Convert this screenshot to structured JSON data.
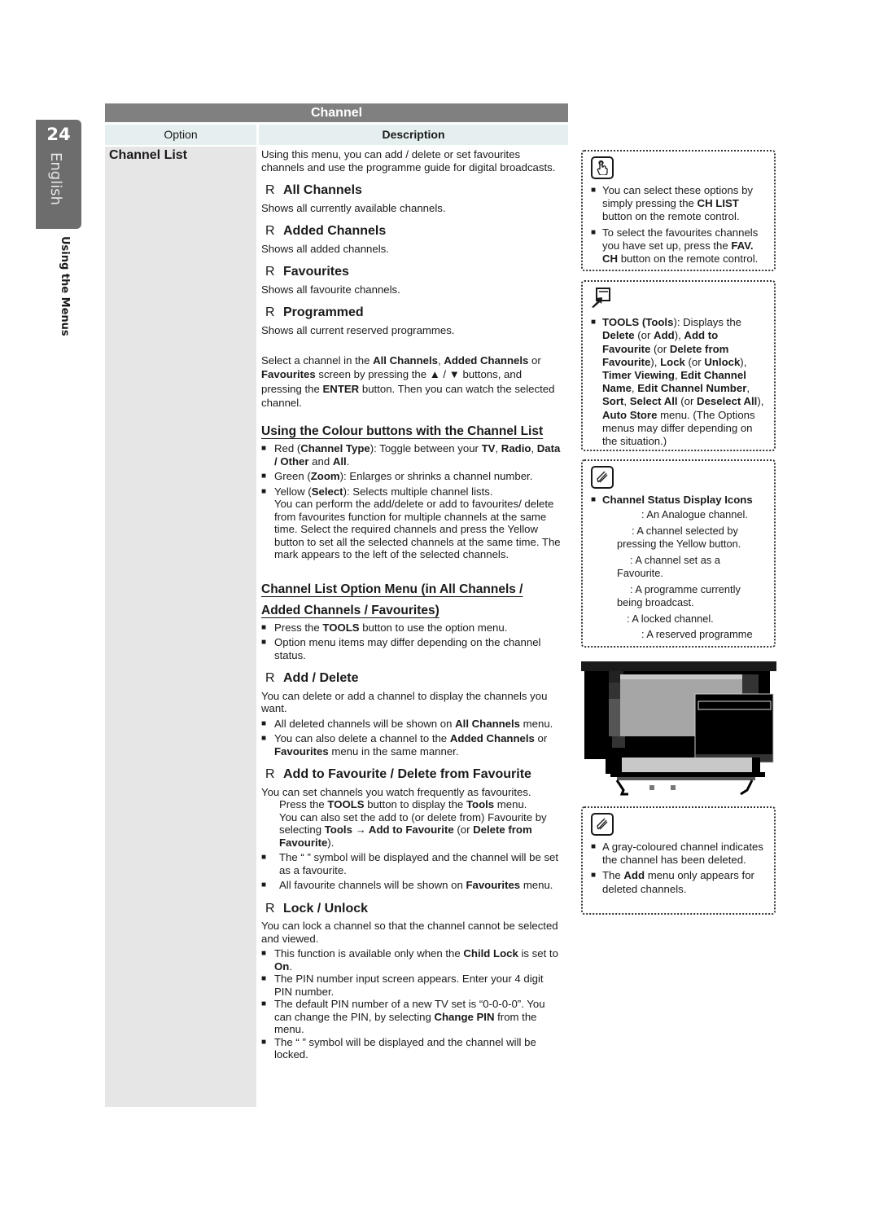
{
  "sidebar": {
    "page_number": "24",
    "language": "English",
    "section": "Using the Menus"
  },
  "table": {
    "title": "Channel",
    "col_option": "Option",
    "col_description": "Description",
    "option_name": "Channel List"
  },
  "desc": {
    "intro": "Using this menu, you can add / delete or set favourites channels and use the programme guide for digital broadcasts.",
    "items": [
      {
        "marker": "R",
        "title": "All Channels",
        "text": "Shows all currently available channels."
      },
      {
        "marker": "R",
        "title": "Added Channels",
        "text": "Shows all added channels."
      },
      {
        "marker": "R",
        "title": "Favourites",
        "text": "Shows all favourite channels."
      },
      {
        "marker": "R",
        "title": "Programmed",
        "text": "Shows all current reserved programmes."
      }
    ],
    "select_para": {
      "t1": "Select a channel in the ",
      "b1": "All Channels",
      "t2": ", ",
      "b2": "Added Channels",
      "t3": " or ",
      "b3": "Favourites",
      "t4": " screen by pressing the ▲ / ▼ buttons, and pressing the ",
      "b4": "ENTER",
      "t5": "      button. Then you can watch the selected channel."
    },
    "colour_heading": "Using the Colour buttons with the Channel List",
    "colour_items": {
      "red": {
        "a": "Red (",
        "b": "Channel Type",
        "c": "): Toggle between your ",
        "d": "TV",
        "e": ", ",
        "f": "Radio",
        "g": ", ",
        "h": "Data / Other",
        "i": " and ",
        "j": "All",
        "k": "."
      },
      "green": {
        "a": "Green (",
        "b": "Zoom",
        "c": "): Enlarges or shrinks a channel number."
      },
      "yellow": {
        "a": "Yellow (",
        "b": "Select",
        "c": "): Selects multiple channel lists.",
        "d": "You can perform the add/delete or add to favourites/ delete from favourites function for multiple channels at the same time. Select the required channels and press the Yellow button to set all the selected channels at the same time. The       mark appears to the left of the selected channels."
      }
    },
    "option_heading_1": "Channel List Option Menu (in All Channels /",
    "option_heading_2": "Added Channels / Favourites)",
    "option_items": {
      "tools": {
        "a": "Press the ",
        "b": "TOOLS",
        "c": " button to use the option menu."
      },
      "differ": "Option menu items may differ depending on the channel status."
    },
    "add_delete": {
      "marker": "R",
      "title": "Add / Delete",
      "text": "You can delete or add a channel to display the channels you want.",
      "b1": {
        "a": "All deleted channels will be shown on ",
        "b": "All Channels",
        "c": " menu."
      },
      "b2": {
        "a": "You can also delete a channel to the ",
        "b": "Added Channels",
        "c": " or ",
        "d": "Favourites",
        "e": " menu in the same manner."
      }
    },
    "add_fav": {
      "marker": "R",
      "title": "Add to Favourite / Delete from Favourite",
      "text": "You can set channels you watch frequently as favourites.",
      "tools": {
        "a": "Press the ",
        "b": "TOOLS",
        "c": " button to display the ",
        "d": "Tools",
        "e": " menu.",
        "f": "You can also set the add to (or delete from) Favourite by selecting ",
        "g": "Tools → Add to Favourite",
        "h": " (or ",
        "i": "Delete from Favourite",
        "j": ")."
      },
      "b1": "The “    ” symbol will be displayed and the channel will be set as a favourite.",
      "b2": {
        "a": "All favourite channels will be shown on ",
        "b": "Favourites",
        "c": " menu."
      }
    },
    "lock": {
      "marker": "R",
      "title": "Lock / Unlock",
      "text": "You can lock a channel so that the channel cannot be selected and viewed.",
      "b1": {
        "a": "This function is available only when the ",
        "b": "Child Lock",
        "c": " is set to ",
        "d": "On",
        "e": "."
      },
      "b2": "The PIN number input screen appears. Enter your 4 digit PIN number.",
      "b3": {
        "a": "The default PIN number of a new TV set is “0-0-0-0”. You can change the PIN, by selecting ",
        "b": "Change PIN",
        "c": " from the menu."
      },
      "b4": "The “    ” symbol will be displayed and the channel will be locked."
    }
  },
  "notes": {
    "remote": {
      "icon": "hand-pointer-icon",
      "b1": {
        "a": "You can select these options by simply pressing the ",
        "b": "CH LIST",
        "c": " button on the remote control."
      },
      "b2": {
        "a": "To select the favourites channels you have set up, press the ",
        "b": "FAV. CH",
        "c": " button on the remote control."
      }
    },
    "tools": {
      "icon": "tools-icon",
      "parts": [
        {
          "t": "TOOLS (Tools",
          "bold": true
        },
        {
          "t": "): Displays the ",
          "bold": false
        },
        {
          "t": "Delete",
          "bold": true
        },
        {
          "t": " (or ",
          "bold": false
        },
        {
          "t": "Add",
          "bold": true
        },
        {
          "t": "), ",
          "bold": false
        },
        {
          "t": "Add to Favourite",
          "bold": true
        },
        {
          "t": " (or ",
          "bold": false
        },
        {
          "t": "Delete from Favourite",
          "bold": true
        },
        {
          "t": "), ",
          "bold": false
        },
        {
          "t": "Lock",
          "bold": true
        },
        {
          "t": " (or ",
          "bold": false
        },
        {
          "t": "Unlock",
          "bold": true
        },
        {
          "t": "), ",
          "bold": false
        },
        {
          "t": "Timer Viewing",
          "bold": true
        },
        {
          "t": ", ",
          "bold": false
        },
        {
          "t": "Edit Channel Name",
          "bold": true
        },
        {
          "t": ", ",
          "bold": false
        },
        {
          "t": "Edit Channel Number",
          "bold": true
        },
        {
          "t": ", ",
          "bold": false
        },
        {
          "t": "Sort",
          "bold": true
        },
        {
          "t": ", ",
          "bold": false
        },
        {
          "t": "Select All",
          "bold": true
        },
        {
          "t": " (or ",
          "bold": false
        },
        {
          "t": "Deselect All",
          "bold": true
        },
        {
          "t": "), ",
          "bold": false
        },
        {
          "t": "Auto Store",
          "bold": true
        },
        {
          "t": " menu. (The Options menus may differ depending on the situation.)",
          "bold": false
        }
      ]
    },
    "status": {
      "icon": "note-pencil-icon",
      "title": "Channel Status Display Icons",
      "lines": [
        ": An Analogue channel.",
        ": A channel selected by pressing the Yellow button.",
        ": A channel set as a Favourite.",
        ": A programme currently being broadcast.",
        ": A locked channel.",
        ": A reserved programme"
      ]
    },
    "deleted": {
      "icon": "note-pencil-icon",
      "b1": "A gray-coloured channel indicates the channel has been deleted.",
      "b2": {
        "a": "The ",
        "b": "Add",
        "c": " menu only appears for deleted channels."
      }
    }
  },
  "colors": {
    "tab": "#6d6d6d",
    "table_header": "#808080",
    "column_header": "#e6efef",
    "option_column": "#e6e6e6"
  }
}
